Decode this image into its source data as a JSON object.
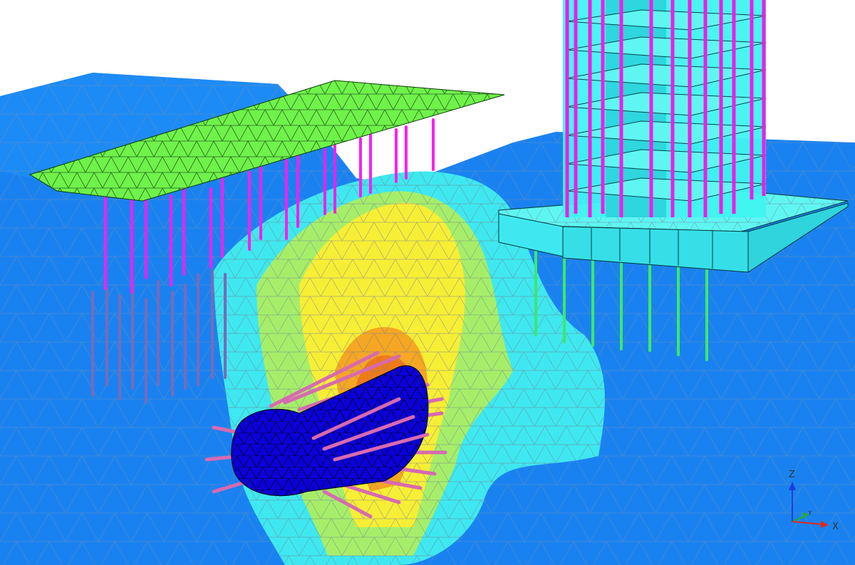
{
  "scene": {
    "colors": {
      "background": "#ffffff",
      "soil": "#1a82f0",
      "mesh_line": "#7a8a9a",
      "contour_cyan": "#3fe8f0",
      "contour_green": "#a6ee6a",
      "contour_yellow": "#f7ee36",
      "contour_orange": "#f5a623",
      "contour_deep_orange": "#ef7a1a",
      "bridge_deck": "#6ff24a",
      "bridge_piles": "#ff1df0",
      "foundation_piles": "#7a6ab8",
      "tower": "#3ff4f0",
      "tower_columns": "#f01de6",
      "raft_piles": "#3be86a",
      "tunnel": "#0a00d8",
      "tunnel_anchors": "#d86ab0"
    },
    "objects": {
      "soil": "soil-mesh",
      "contour": "displacement-contour",
      "bridge": "bridge-deck",
      "bridge_piles": "bridge-piles",
      "foundation_piles": "foundation-piles",
      "tower": "tower-structure",
      "raft": "raft-foundation",
      "raft_piles": "raft-piles",
      "tunnel": "tunnel-lining",
      "anchors": "rock-bolts"
    }
  },
  "axes": {
    "z_label": "Z",
    "y_label": "Y",
    "x_label": "X",
    "z_color": "#1a3fd8",
    "y_color": "#1fae2a",
    "x_color": "#e02a1a"
  }
}
